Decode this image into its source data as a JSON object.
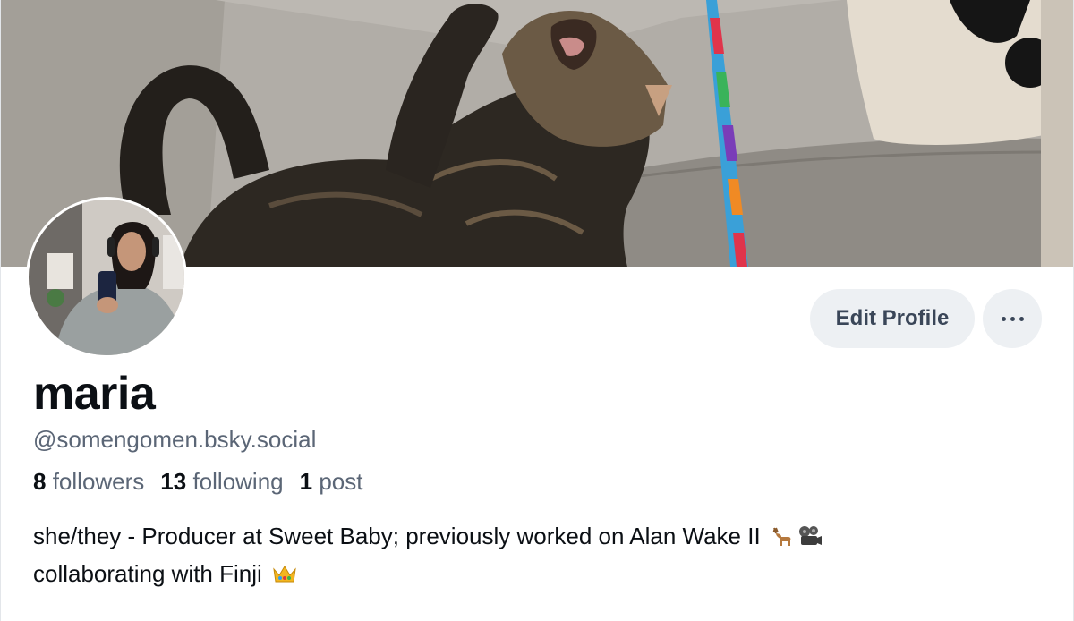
{
  "banner": {
    "image": "cat-playing-with-rainbow-wand-on-sofa",
    "colors": {
      "sofa": "#a9a59f",
      "cat": "#2d2822"
    }
  },
  "avatar": {
    "image": "person-taking-mirror-selfie-with-headphones"
  },
  "actions": {
    "edit_profile_label": "Edit Profile",
    "more_icon": "ellipsis-icon"
  },
  "profile": {
    "display_name": "maria",
    "handle": "@somengomen.bsky.social"
  },
  "stats": {
    "followers_count": "8",
    "followers_label": "followers",
    "following_count": "13",
    "following_label": "following",
    "posts_count": "1",
    "posts_label": "post"
  },
  "bio": {
    "line1": "she/they - Producer at Sweet Baby; previously worked on Alan Wake II",
    "line1_emojis": [
      "deer-emoji",
      "film-projector-emoji"
    ],
    "line2": "collaborating with Finji",
    "line2_emojis": [
      "crown-emoji"
    ]
  },
  "theme": {
    "button_bg": "#edf0f3",
    "text_primary": "#0b0f14",
    "text_secondary": "#5b6676"
  }
}
